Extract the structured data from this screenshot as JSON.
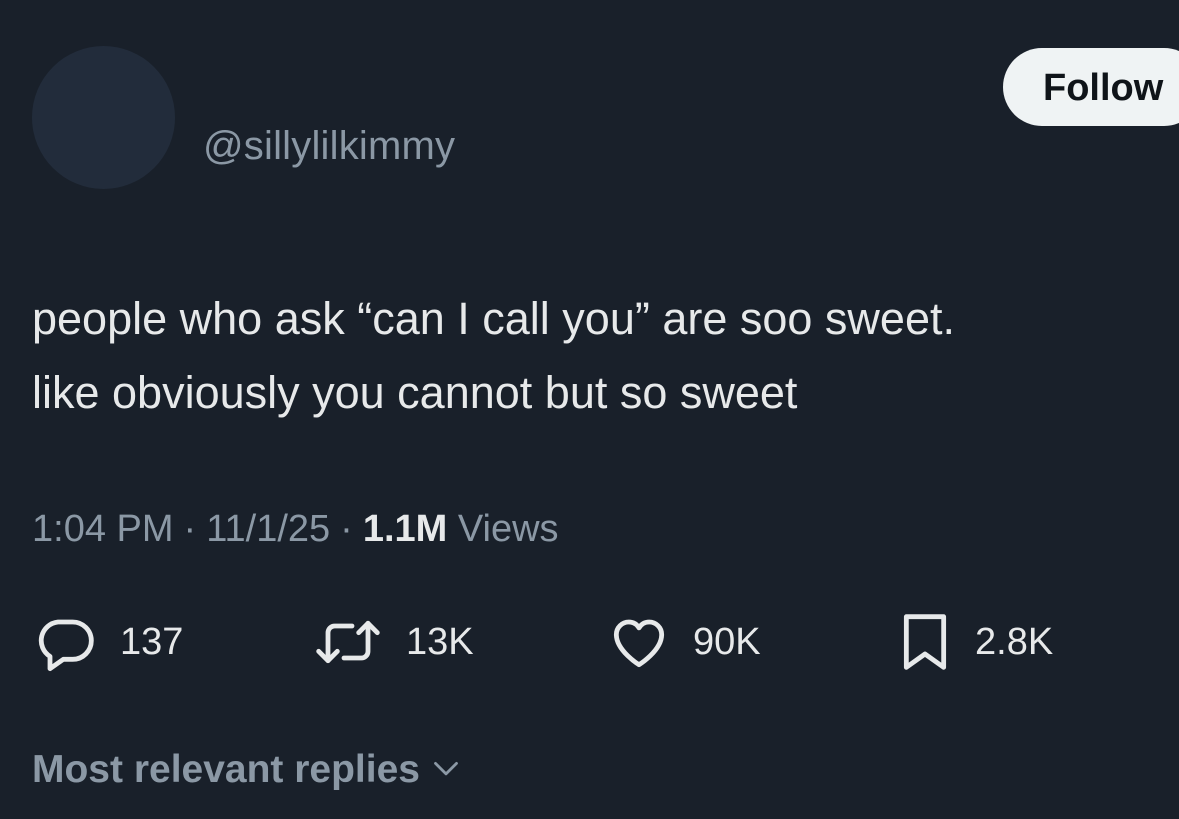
{
  "author": {
    "handle": "@sillylilkimmy"
  },
  "follow_button": {
    "label": "Follow"
  },
  "tweet": {
    "lines": [
      "people who ask “can I call you” are soo sweet.",
      "like obviously you cannot but so sweet"
    ]
  },
  "meta": {
    "time": "1:04 PM",
    "date": "11/1/25",
    "separator": "·",
    "views_count": "1.1M",
    "views_label": "Views"
  },
  "actions": {
    "replies": "137",
    "reposts": "13K",
    "likes": "90K",
    "bookmarks": "2.8K"
  },
  "replies_sort": {
    "label": "Most relevant replies"
  },
  "icons": {
    "reply": "reply-bubble-icon",
    "repost": "repost-arrows-icon",
    "like": "heart-icon",
    "bookmark": "bookmark-icon",
    "sort": "chevron-down-icon"
  },
  "colors": {
    "background": "#19202a",
    "text_primary": "#e7e9ea",
    "text_secondary": "#8b98a5",
    "follow_button_bg": "#eff3f4"
  }
}
